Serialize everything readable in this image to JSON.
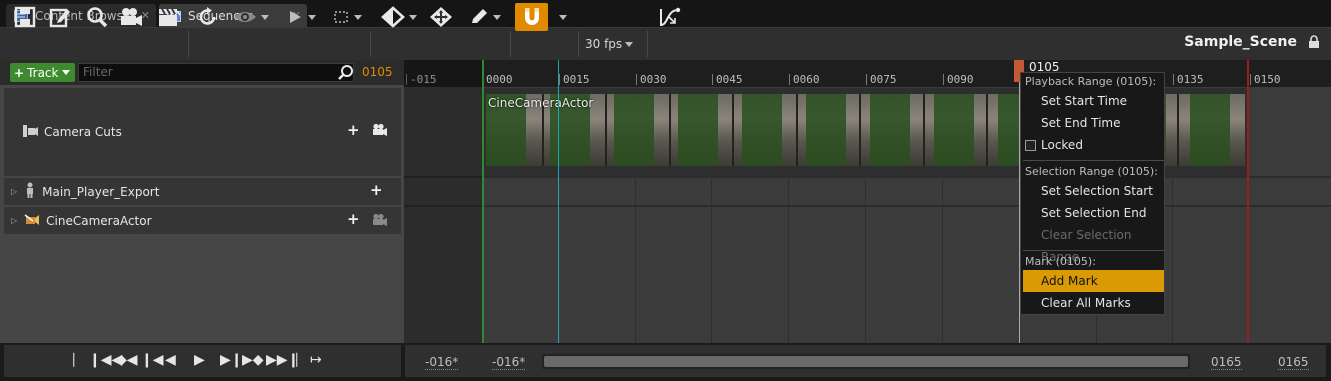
{
  "tabs": [
    {
      "label": "Content Browser",
      "icon": "content-browser-icon",
      "active": false
    },
    {
      "label": "Sequencer",
      "icon": "sequencer-icon",
      "active": true
    }
  ],
  "toolbar": {
    "fps_label": "30 fps",
    "scene_name": "Sample_Scene",
    "accent_color": "#e08a00"
  },
  "tracks": {
    "add_button_label": "Track",
    "filter_placeholder": "Filter",
    "current_frame": "0105",
    "items": [
      {
        "label": "Camera Cuts",
        "icon": "camera-cuts-icon"
      },
      {
        "label": "Main_Player_Export",
        "icon": "actor-figure-icon"
      },
      {
        "label": "CineCameraActor",
        "icon": "cine-camera-icon"
      }
    ]
  },
  "timeline": {
    "ruler_labels": [
      "-015",
      "0000",
      "0015",
      "0030",
      "0045",
      "0060",
      "0075",
      "0090",
      "0135",
      "0150"
    ],
    "playhead_label": "0105",
    "section_label": "CineCameraActor"
  },
  "context_menu": {
    "playback_header": "Playback Range (0105):",
    "set_start_time": "Set Start Time",
    "set_end_time": "Set End Time",
    "locked": "Locked",
    "selection_header": "Selection Range (0105):",
    "set_selection_start": "Set Selection Start",
    "set_selection_end": "Set Selection End",
    "clear_selection_range": "Clear Selection Range",
    "mark_header": "Mark (0105):",
    "add_mark": "Add Mark",
    "clear_all_marks": "Clear All Marks"
  },
  "range": {
    "view_start": "-016*",
    "working_start": "-016*",
    "working_end": "0165",
    "view_end": "0165"
  }
}
